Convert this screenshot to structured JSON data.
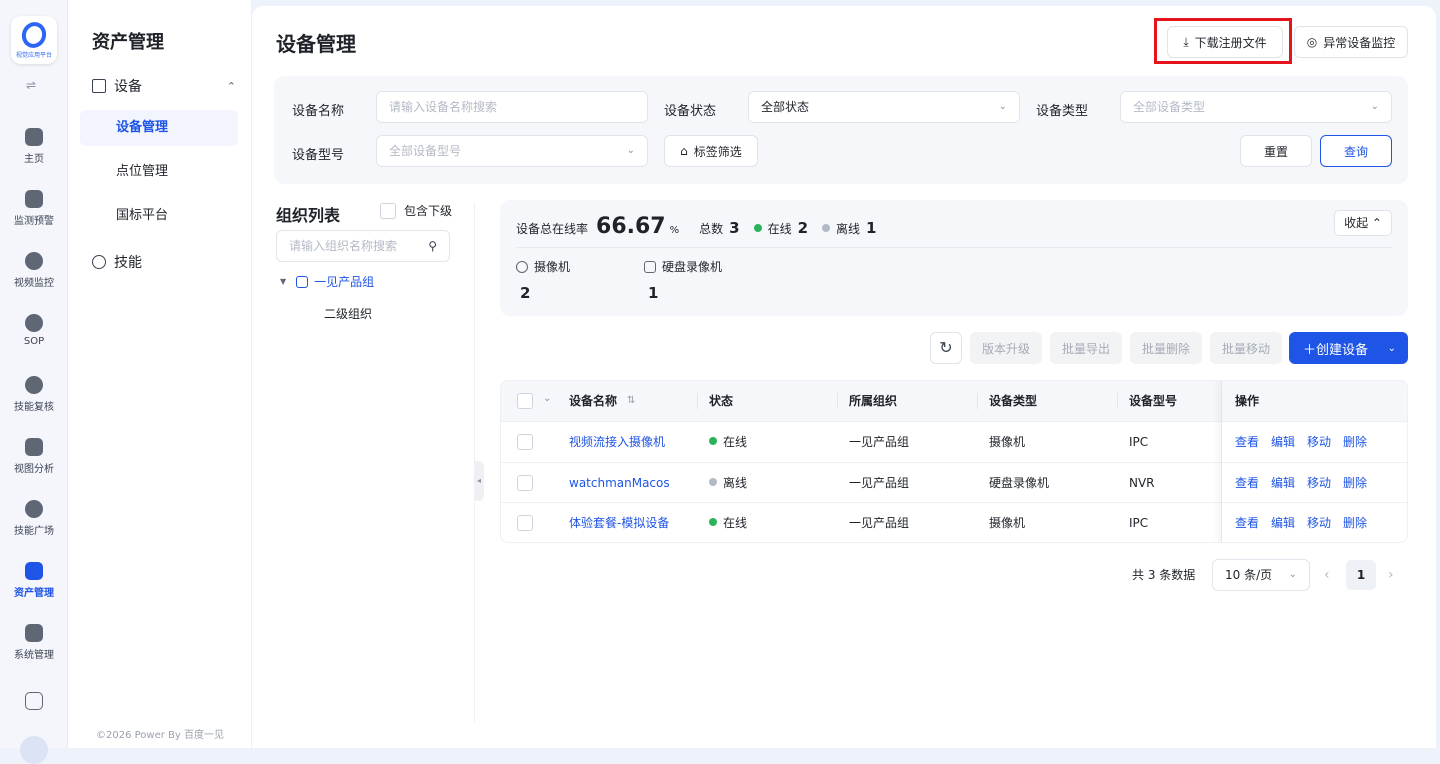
{
  "rail": {
    "logo_text": "视觉应用平台",
    "toggle_icon": "⇌",
    "items": [
      {
        "label": "主页",
        "icon": "home-icon"
      },
      {
        "label": "监测预警",
        "icon": "chart-icon"
      },
      {
        "label": "视频监控",
        "icon": "camera-icon"
      },
      {
        "label": "SOP",
        "icon": "sop-icon"
      },
      {
        "label": "技能复核",
        "icon": "review-icon"
      },
      {
        "label": "视图分析",
        "icon": "analysis-icon"
      },
      {
        "label": "技能广场",
        "icon": "skills-icon"
      },
      {
        "label": "资产管理",
        "icon": "asset-icon",
        "active": true
      },
      {
        "label": "系统管理",
        "icon": "system-icon"
      }
    ]
  },
  "menu": {
    "title": "资产管理",
    "group_label": "设备",
    "group_chevron": "⌃",
    "sub_items": [
      "设备管理",
      "点位管理",
      "国标平台"
    ],
    "skill_label": "技能",
    "copyright": "©2026 Power By 百度一见"
  },
  "header": {
    "title": "设备管理",
    "download_label": "下载注册文件",
    "download_icon": "⤓",
    "abnormal_label": "异常设备监控",
    "abnormal_icon": "◎"
  },
  "filters": {
    "name_label": "设备名称",
    "name_placeholder": "请输入设备名称搜索",
    "status_label": "设备状态",
    "status_value": "全部状态",
    "type_label": "设备类型",
    "type_placeholder": "全部设备类型",
    "model_label": "设备型号",
    "model_placeholder": "全部设备型号",
    "tag_label": "标签筛选",
    "reset_label": "重置",
    "query_label": "查询",
    "dropdown_icon": "⌄"
  },
  "org": {
    "title": "组织列表",
    "include_label": "包含下级",
    "search_placeholder": "请输入组织名称搜索",
    "search_icon": "⚲",
    "tree_root": "一见产品组",
    "tree_child": "二级组织",
    "tree_arrow": "▼",
    "collapse_icon": "◂"
  },
  "stats": {
    "online_rate_label": "设备总在线率",
    "online_rate_value": "66.67",
    "online_rate_unit": "%",
    "total_label": "总数",
    "total_value": "3",
    "online_label": "在线",
    "online_value": "2",
    "offline_label": "离线",
    "offline_value": "1",
    "collapse_label": "收起 ⌃",
    "camera_label": "摄像机",
    "camera_value": "2",
    "nvr_label": "硬盘录像机",
    "nvr_value": "1",
    "online_color": "#2bb35a",
    "offline_color": "#b4bac5"
  },
  "toolbar": {
    "refresh_icon": "↻",
    "upgrade_label": "版本升级",
    "export_label": "批量导出",
    "delete_label": "批量删除",
    "move_label": "批量移动",
    "create_label": "＋创建设备",
    "create_dd": "⌄"
  },
  "table": {
    "headers": {
      "name": "设备名称",
      "sort": "⇅",
      "status": "状态",
      "org": "所属组织",
      "type": "设备类型",
      "model": "设备型号",
      "ops": "操作"
    },
    "rows": [
      {
        "name": "视频流接入摄像机",
        "status": "在线",
        "org": "一见产品组",
        "type": "摄像机",
        "model": "IPC"
      },
      {
        "name": "watchmanMacos",
        "status": "离线",
        "org": "一见产品组",
        "type": "硬盘录像机",
        "model": "NVR"
      },
      {
        "name": "体验套餐-模拟设备",
        "status": "在线",
        "org": "一见产品组",
        "type": "摄像机",
        "model": "IPC"
      }
    ],
    "ops": [
      "查看",
      "编辑",
      "移动",
      "删除"
    ]
  },
  "pagination": {
    "total_text": "共 3 条数据",
    "page_size": "10 条/页",
    "current_page": "1",
    "prev": "‹",
    "next": "›"
  }
}
